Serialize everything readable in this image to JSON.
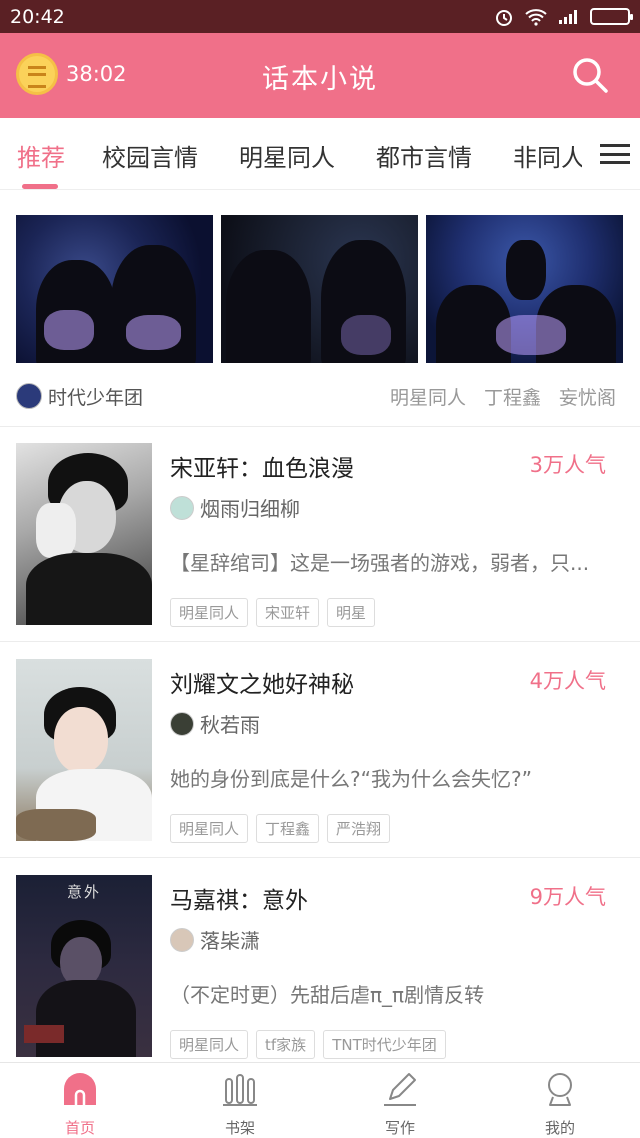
{
  "status": {
    "time": "20:42"
  },
  "header": {
    "timer": "38:02",
    "title": "话本小说"
  },
  "tabs": [
    {
      "label": "推荐",
      "active": true
    },
    {
      "label": "校园言情"
    },
    {
      "label": "明星同人"
    },
    {
      "label": "都市言情"
    },
    {
      "label": "非同人:"
    }
  ],
  "featured": {
    "author": "时代少年团",
    "tags": [
      "明星同人",
      "丁程鑫",
      "妄忧阁"
    ]
  },
  "books": [
    {
      "title": "宋亚轩：血色浪漫",
      "popularity": "3万人气",
      "author": "烟雨归细柳",
      "description": "【星辞绾司】这是一场强者的游戏，弱者，只...",
      "tags": [
        "明星同人",
        "宋亚轩",
        "明星"
      ]
    },
    {
      "title": "刘耀文之她好神秘",
      "popularity": "4万人气",
      "author": "秋若雨",
      "description": "她的身份到底是什么?“我为什么会失忆?”",
      "tags": [
        "明星同人",
        "丁程鑫",
        "严浩翔"
      ]
    },
    {
      "title": "马嘉祺：意外",
      "popularity": "9万人气",
      "author": "落枈潇",
      "description": "（不定时更）先甜后虐π_π剧情反转",
      "tags": [
        "明星同人",
        "tf家族",
        "TNT时代少年团"
      ],
      "cover_text": "意外"
    }
  ],
  "nav": [
    {
      "label": "首页",
      "icon": "home-icon",
      "active": true
    },
    {
      "label": "书架",
      "icon": "bookshelf-icon"
    },
    {
      "label": "写作",
      "icon": "pen-icon"
    },
    {
      "label": "我的",
      "icon": "profile-icon"
    }
  ],
  "colors": {
    "accent": "#f07089",
    "statusbar": "#5a2024"
  }
}
